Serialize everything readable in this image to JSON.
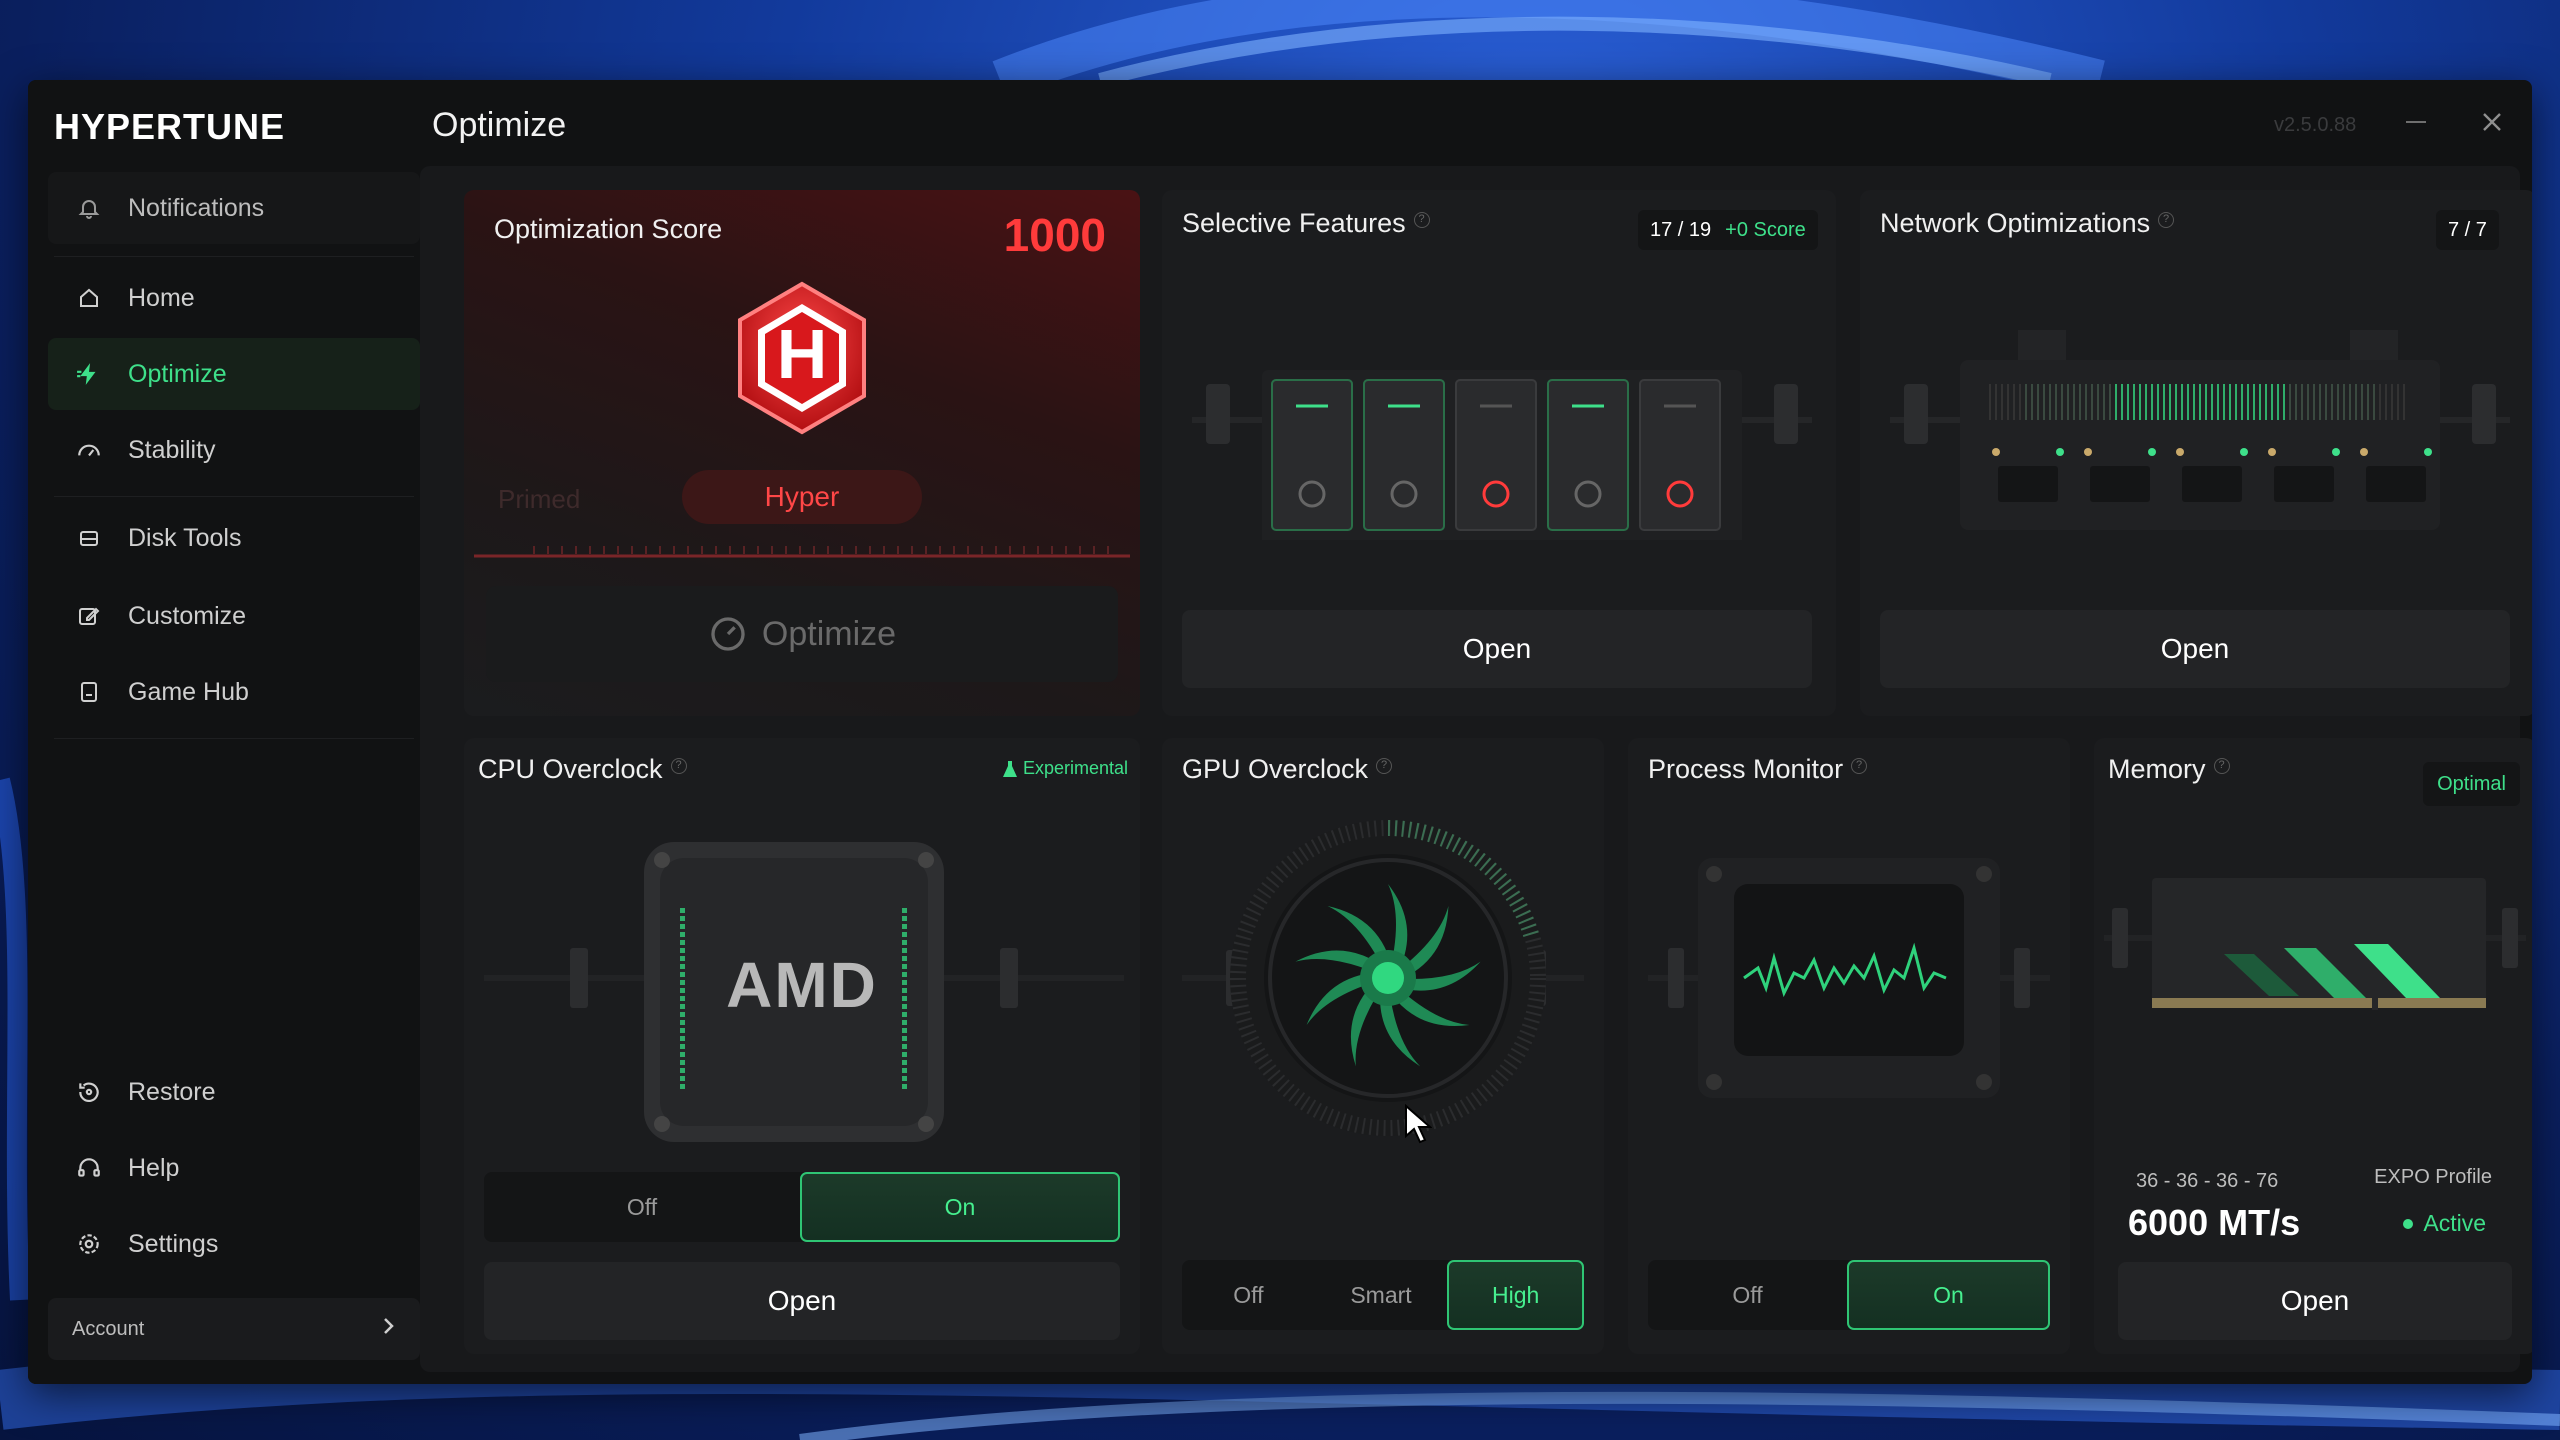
{
  "app": {
    "brand": "HYPERTUNE",
    "page_title": "Optimize",
    "version": "v2.5.0.88"
  },
  "sidebar": {
    "notifications": "Notifications",
    "items": [
      {
        "label": "Home",
        "icon": "home-icon"
      },
      {
        "label": "Optimize",
        "icon": "bolt-icon",
        "active": true
      },
      {
        "label": "Stability",
        "icon": "gauge-icon"
      },
      {
        "label": "Disk Tools",
        "icon": "disk-icon"
      },
      {
        "label": "Customize",
        "icon": "edit-icon"
      },
      {
        "label": "Game Hub",
        "icon": "gamepad-icon"
      }
    ],
    "bottom_items": [
      {
        "label": "Restore",
        "icon": "restore-icon"
      },
      {
        "label": "Help",
        "icon": "headset-icon"
      },
      {
        "label": "Settings",
        "icon": "gear-icon"
      }
    ],
    "account": "Account"
  },
  "score_card": {
    "title": "Optimization Score",
    "score": "1000",
    "logo_letter": "H",
    "tier_prev": "Primed",
    "tier_current": "Hyper",
    "optimize_button": "Optimize"
  },
  "selective_features": {
    "title": "Selective Features",
    "count": "17 / 19",
    "score": "+0 Score",
    "open": "Open"
  },
  "network": {
    "title": "Network Optimizations",
    "count": "7 / 7",
    "open": "Open"
  },
  "cpu": {
    "title": "CPU Overclock",
    "tag": "Experimental",
    "chip_text": "AMD",
    "off": "Off",
    "on": "On",
    "state": "On",
    "open": "Open"
  },
  "gpu": {
    "title": "GPU Overclock",
    "options": [
      "Off",
      "Smart",
      "High"
    ],
    "state": "High"
  },
  "process": {
    "title": "Process Monitor",
    "off": "Off",
    "on": "On",
    "state": "On"
  },
  "memory": {
    "title": "Memory",
    "status": "Optimal",
    "timings": "36 - 36 - 36 - 76",
    "speed": "6000 MT/s",
    "profile_label": "EXPO Profile",
    "profile_state": "Active",
    "open": "Open"
  },
  "colors": {
    "accent_green": "#3ee08a",
    "accent_red": "#ff3b3b",
    "bg": "#111213"
  }
}
